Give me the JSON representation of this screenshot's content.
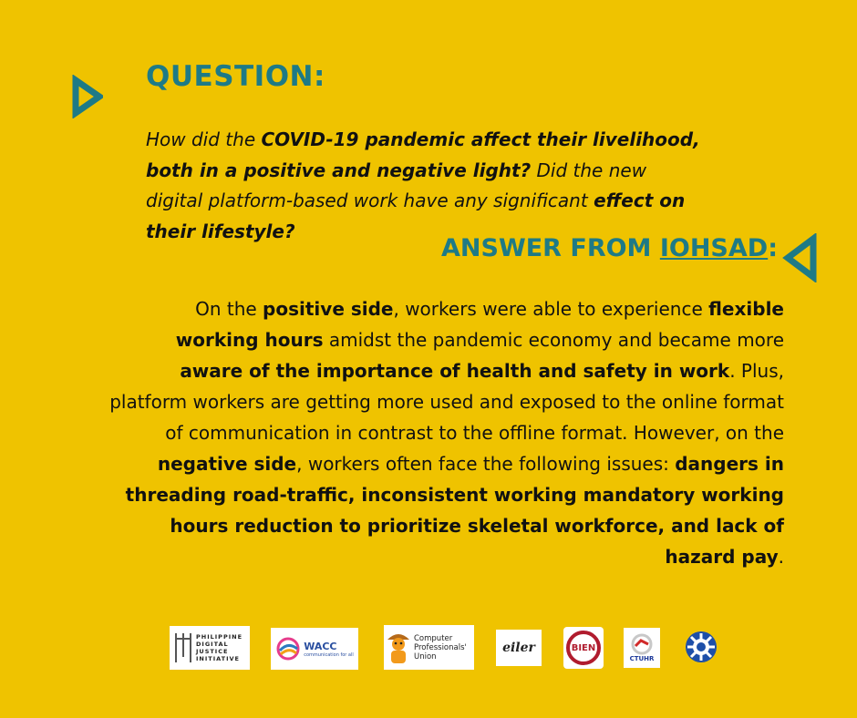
{
  "colors": {
    "background": "#efc300",
    "accent": "#1e7a86",
    "text": "#111111"
  },
  "question": {
    "title": "QUESTION:",
    "parts": [
      {
        "text": "How did the ",
        "bold": false
      },
      {
        "text": "COVID-19 pandemic affect their livelihood, both in a positive and negative light?",
        "bold": true
      },
      {
        "text": " Did the new digital platform-based work have any significant ",
        "bold": false
      },
      {
        "text": "effect on their lifestyle?",
        "bold": true
      }
    ]
  },
  "answer": {
    "title_prefix": "ANSWER FROM ",
    "title_org": "IOHSAD",
    "title_suffix": ":",
    "parts": [
      {
        "text": "On the ",
        "bold": false
      },
      {
        "text": "positive side",
        "bold": true
      },
      {
        "text": ", workers were able to experience ",
        "bold": false
      },
      {
        "text": "flexible working hours",
        "bold": true
      },
      {
        "text": " amidst the pandemic economy and became more ",
        "bold": false
      },
      {
        "text": "aware of the importance of health and safety in work",
        "bold": true
      },
      {
        "text": ". Plus, platform workers are getting more used and exposed to the online format of communication in contrast to the offline format. However, on the ",
        "bold": false
      },
      {
        "text": "negative side",
        "bold": true
      },
      {
        "text": ", workers often face the following issues: ",
        "bold": false
      },
      {
        "text": "dangers in threading road-traffic, inconsistent working mandatory working hours reduction to prioritize skeletal workforce, and lack of hazard pay",
        "bold": true
      },
      {
        "text": ".",
        "bold": false
      }
    ]
  },
  "logos": {
    "pdji": "PHILIPPINE DIGITAL JUSTICE INITIATIVE",
    "wacc": "WACC",
    "wacc_tagline": "communication for all",
    "cpu": "Computer Professionals' Union",
    "eiler": "eiler",
    "bien": "BIEN",
    "ctuhr": "CTUHR",
    "gear_icon": "gear-icon"
  }
}
